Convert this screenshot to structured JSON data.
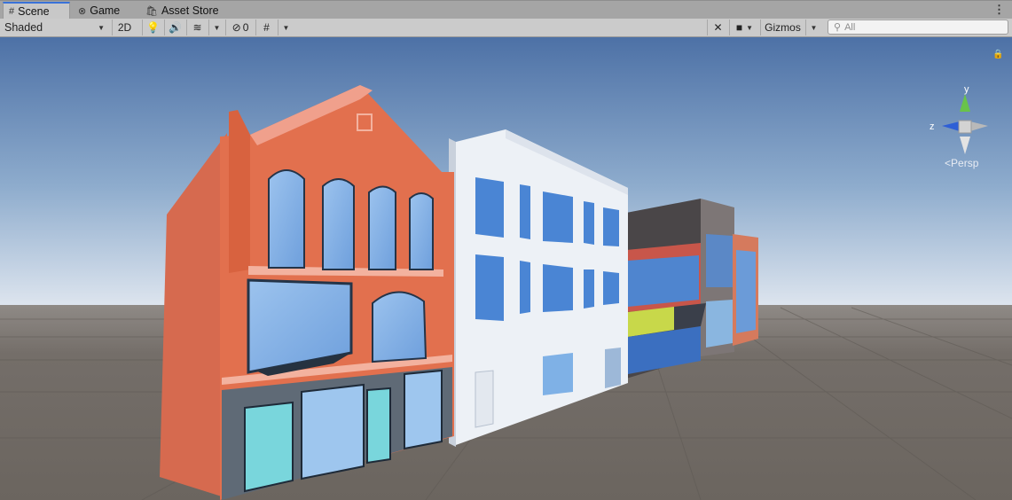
{
  "tabs": [
    {
      "label": "Scene",
      "icon": "grid-icon",
      "active": true
    },
    {
      "label": "Game",
      "icon": "gamepad-icon",
      "active": false
    },
    {
      "label": "Asset Store",
      "icon": "shopping-bag-icon",
      "active": false
    }
  ],
  "toolbar": {
    "draw_mode": "Shaded",
    "mode_2d": "2D",
    "hidden_count": "0",
    "gizmos_label": "Gizmos",
    "search_placeholder": "All"
  },
  "orientation_gizmo": {
    "y_label": "y",
    "z_label": "z",
    "projection": "Persp"
  },
  "colors": {
    "accent": "#3a72d8",
    "sky_top": "#4e73a8",
    "ground": "#6f6964",
    "gizmo_y": "#69c34a",
    "gizmo_z": "#2e5fd6"
  }
}
